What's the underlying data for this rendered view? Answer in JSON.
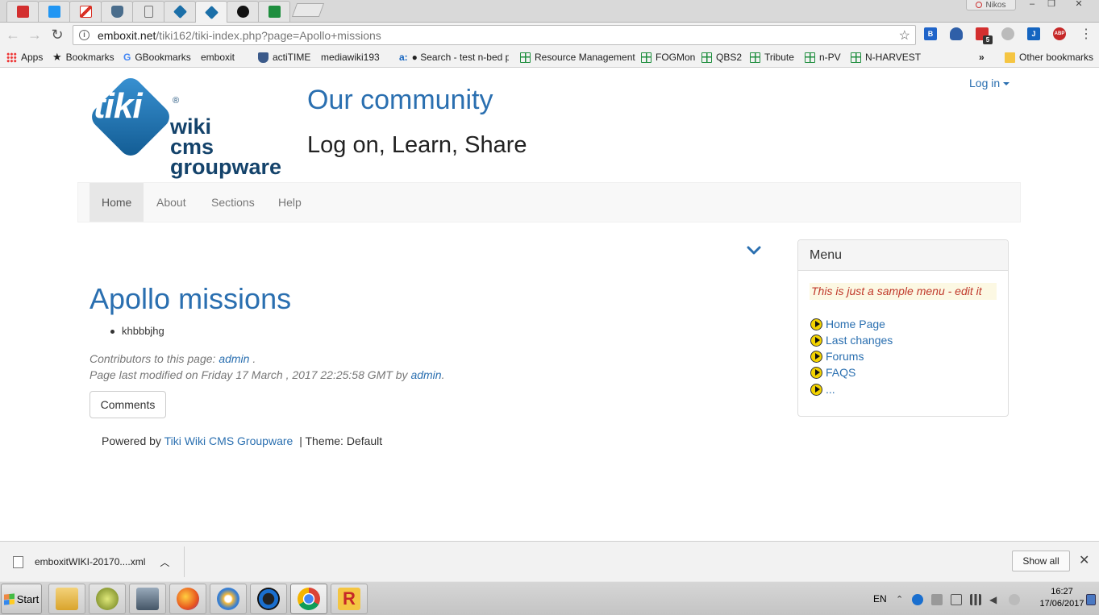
{
  "browser": {
    "user_name": "Nikos",
    "url_host": "emboxit.net",
    "url_path": "/tiki162/tiki-index.php?page=Apollo+missions",
    "extensions_badge": "5",
    "abp_label": "ABP",
    "bookmarks": [
      {
        "label": "Apps",
        "icon": "apps-grid-icon"
      },
      {
        "label": "Bookmarks",
        "icon": "star-icon"
      },
      {
        "label": "GBookmarks",
        "icon": "google-icon"
      },
      {
        "label": "emboxit",
        "icon": "page-icon"
      },
      {
        "label": "actiTIME",
        "icon": "shield-icon"
      },
      {
        "label": "mediawiki193",
        "icon": "page-icon"
      },
      {
        "label": "● Search - test n-bed pr",
        "icon": "a-icon"
      },
      {
        "label": "Resource Management",
        "icon": "sheet-icon"
      },
      {
        "label": "FOGMon",
        "icon": "sheet-icon"
      },
      {
        "label": "QBS2",
        "icon": "sheet-icon"
      },
      {
        "label": "Tribute",
        "icon": "sheet-icon"
      },
      {
        "label": "n-PV",
        "icon": "sheet-icon"
      },
      {
        "label": "N-HARVEST",
        "icon": "sheet-icon"
      }
    ],
    "overflow_label": "»",
    "other_bookmarks": "Other bookmarks"
  },
  "site": {
    "logo_word": "tiki",
    "logo_reg": "®",
    "logo_lines": [
      "wiki",
      "cms",
      "groupware"
    ],
    "title": "Our community",
    "slogan": "Log on, Learn, Share",
    "login": "Log in",
    "nav": [
      "Home",
      "About",
      "Sections",
      "Help"
    ]
  },
  "content": {
    "heading": "Apollo missions",
    "bullets": [
      "khbbbjhg"
    ],
    "contributors_prefix": "Contributors to this page: ",
    "contributor": "admin",
    "contributors_suffix": " .",
    "modified_prefix": "Page last modified on Friday 17 March , 2017 22:25:58 GMT by ",
    "modified_by": "admin",
    "modified_suffix": ".",
    "comments_button": "Comments"
  },
  "footer": {
    "powered_prefix": "Powered by ",
    "powered_link": "Tiki Wiki CMS Groupware",
    "theme": "| Theme: Default"
  },
  "menu": {
    "title": "Menu",
    "note": "This is just a sample menu - edit it",
    "items": [
      "Home Page",
      "Last changes",
      "Forums",
      "FAQS",
      "..."
    ]
  },
  "downloads": {
    "file": "emboxitWIKI-20170....xml",
    "show_all": "Show all"
  },
  "taskbar": {
    "start": "Start",
    "lang": "EN",
    "time": "16:27",
    "date": "17/06/2017"
  },
  "colors": {
    "link": "#2a6fb0",
    "tiki_blue": "#1b6fa8",
    "menu_note": "#c0392b"
  }
}
